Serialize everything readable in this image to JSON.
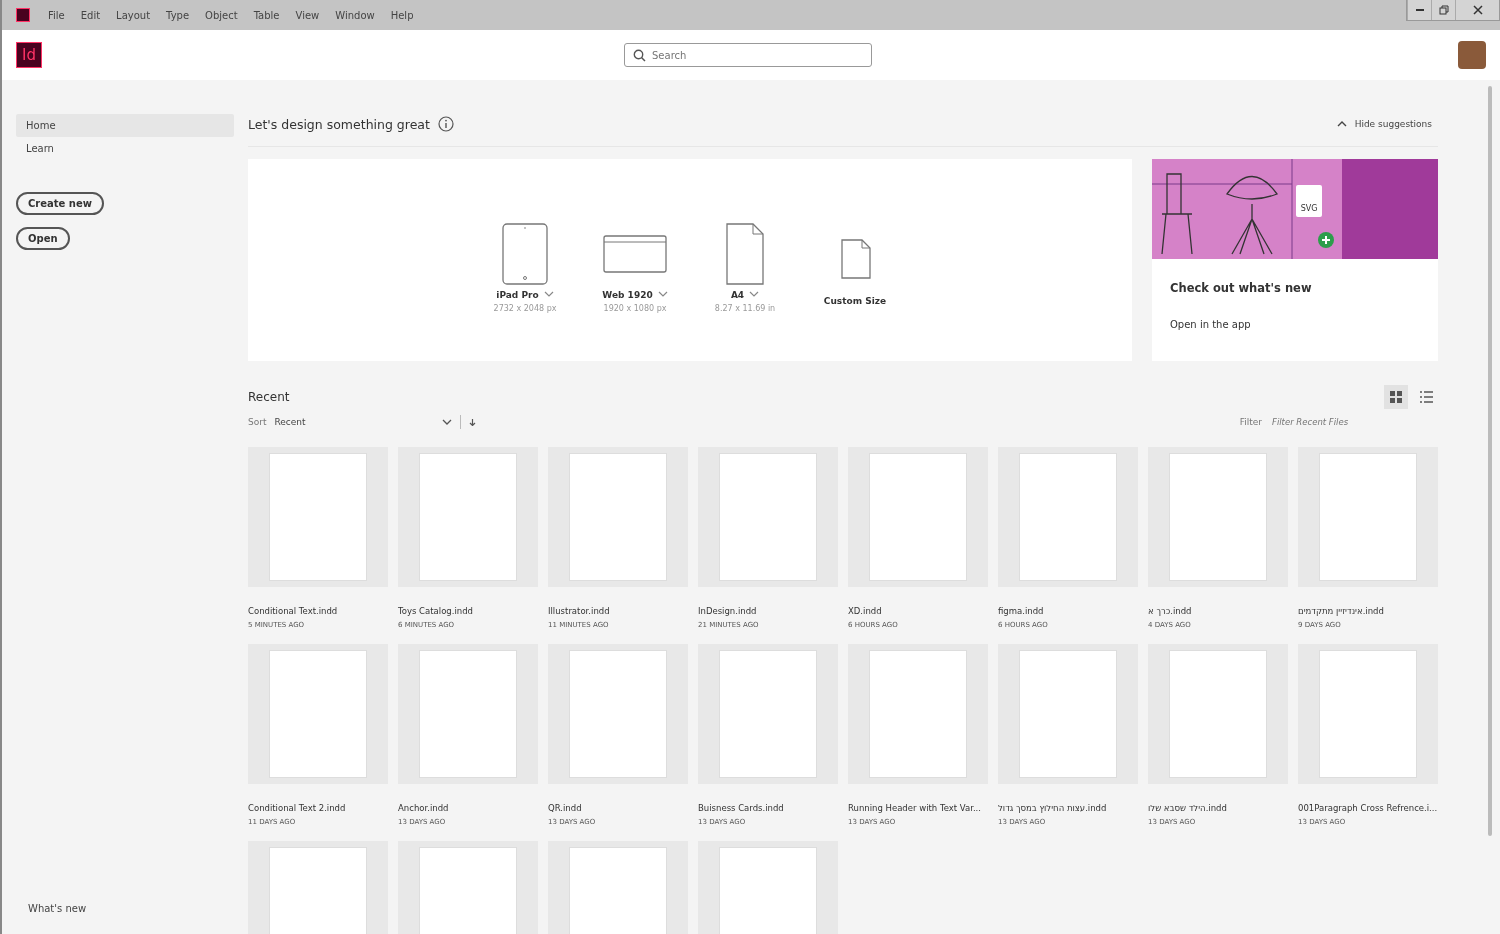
{
  "menu_bar": {
    "items": [
      "File",
      "Edit",
      "Layout",
      "Type",
      "Object",
      "Table",
      "View",
      "Window",
      "Help"
    ]
  },
  "header": {
    "logo": "Id",
    "search": {
      "placeholder": "Search"
    }
  },
  "sidebar": {
    "items": [
      {
        "label": "Home",
        "selected": true
      },
      {
        "label": "Learn",
        "selected": false
      }
    ],
    "buttons": [
      "Create new",
      "Open"
    ],
    "footer_link": "What's new"
  },
  "suggestions": {
    "title": "Let's design something great",
    "toggle": "Hide suggestions",
    "presets": [
      {
        "kind": "tablet",
        "name": "iPad Pro",
        "size": "2732 x 2048 px",
        "dropdown": true
      },
      {
        "kind": "web",
        "name": "Web 1920",
        "size": "1920 x 1080 px",
        "dropdown": true
      },
      {
        "kind": "page",
        "name": "A4",
        "size": "8.27 x 11.69 in",
        "dropdown": true
      },
      {
        "kind": "custom",
        "name": "Custom Size",
        "dropdown": false
      }
    ],
    "promo": {
      "title": "Check out what's new",
      "link": "Open in the app",
      "badge": "SVG"
    }
  },
  "recent": {
    "title": "Recent",
    "sort_label": "Sort",
    "sort_value": "Recent",
    "filter_label": "Filter",
    "filter_placeholder": "Filter Recent Files",
    "views": [
      {
        "kind": "grid",
        "selected": true
      },
      {
        "kind": "list",
        "selected": false
      }
    ],
    "files": [
      {
        "kind": "file",
        "name": "Conditional Text.indd",
        "time": "5 MINUTES AGO"
      },
      {
        "kind": "file",
        "name": "Toys Catalog.indd",
        "time": "6 MINUTES AGO"
      },
      {
        "kind": "file",
        "name": "Illustrator.indd",
        "time": "11 MINUTES AGO"
      },
      {
        "kind": "file",
        "name": "InDesign.indd",
        "time": "21 MINUTES AGO"
      },
      {
        "kind": "file",
        "name": "XD.indd",
        "time": "6 HOURS AGO"
      },
      {
        "kind": "file",
        "name": "figma.indd",
        "time": "6 HOURS AGO"
      },
      {
        "kind": "file",
        "name": "כרך א.indd",
        "time": "4 DAYS AGO"
      },
      {
        "kind": "file",
        "name": "אינדיזיין מתקדמים.indd",
        "time": "9 DAYS AGO"
      },
      {
        "kind": "file",
        "name": "Conditional Text 2.indd",
        "time": "11 DAYS AGO"
      },
      {
        "kind": "file",
        "name": "Anchor.indd",
        "time": "13 DAYS AGO"
      },
      {
        "kind": "file",
        "name": "QR.indd",
        "time": "13 DAYS AGO"
      },
      {
        "kind": "file",
        "name": "Buisness Cards.indd",
        "time": "13 DAYS AGO"
      },
      {
        "kind": "file",
        "name": "Running Header with Text Var...",
        "time": "13 DAYS AGO"
      },
      {
        "kind": "file",
        "name": "עצות החילוץ במסך גדול.indd",
        "time": "13 DAYS AGO"
      },
      {
        "kind": "file",
        "name": "הילד שסבא שלו.indd",
        "time": "13 DAYS AGO"
      },
      {
        "kind": "file",
        "name": "001Paragraph Cross Refrence.i...",
        "time": "13 DAYS AGO"
      },
      {
        "kind": "partial"
      },
      {
        "kind": "partial"
      },
      {
        "kind": "partial"
      },
      {
        "kind": "partial"
      }
    ]
  }
}
